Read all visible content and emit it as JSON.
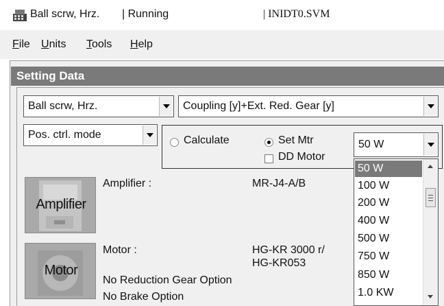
{
  "titlebar": {
    "app_name": "Ball scrw, Hrz.",
    "status": "| Running",
    "file": "| INIDT0.SVM"
  },
  "menu": {
    "file": {
      "accel": "F",
      "rest": "ile"
    },
    "units": {
      "accel": "U",
      "rest": "nits"
    },
    "tools": {
      "accel": "T",
      "rest": "ools"
    },
    "help": {
      "accel": "H",
      "rest": "elp"
    }
  },
  "section_title": "Setting Data",
  "mechanism_select": "Ball scrw, Hrz.",
  "coupling_select": "Coupling [y]+Ext. Red. Gear [y]",
  "control_mode_select": "Pos. ctrl. mode",
  "mode": {
    "calculate_label": "Calculate",
    "set_motor_label": "Set Mtr",
    "selected": "Set Mtr",
    "dd_motor_label": "DD Motor",
    "dd_motor_checked": false
  },
  "capacity_select": {
    "value": "50 W",
    "options": [
      "50 W",
      "100 W",
      "200 W",
      "400 W",
      "500 W",
      "750 W",
      "850 W",
      "1.0 KW"
    ],
    "highlighted": "50 W"
  },
  "amplifier": {
    "button_label": "Amplifier",
    "caption": "Amplifier :",
    "model": "MR-J4-A/B"
  },
  "motor": {
    "button_label": "Motor",
    "caption": "Motor :",
    "model_line1": "HG-KR  3000 r/",
    "model_line2": "HG-KR053",
    "reduction": "No Reduction Gear Option",
    "brake": "No Brake Option"
  },
  "colors": {
    "header_bg": "#7a7a7a",
    "selection_bg": "#7a7a7a",
    "window_bg": "#f0f0f0"
  }
}
